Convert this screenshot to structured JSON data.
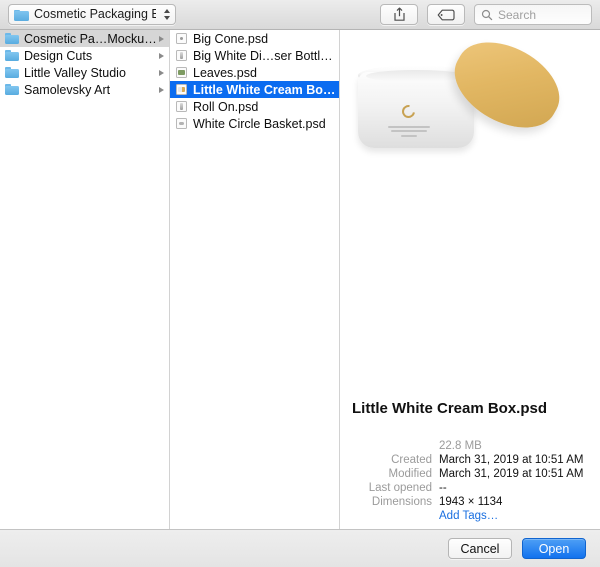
{
  "toolbar": {
    "location_label": "Cosmetic Packaging Br…",
    "folder_icon": "folder-icon",
    "chevron_icon": "chevron-up-down-icon",
    "share_icon": "share-icon",
    "tag_icon": "tag-icon",
    "search_icon": "search-icon",
    "search_placeholder": "Search",
    "search_value": ""
  },
  "sidebar": {
    "items": [
      {
        "label": "Cosmetic Pa…Mockup Zone",
        "selected": true
      },
      {
        "label": "Design Cuts",
        "selected": false
      },
      {
        "label": "Little Valley Studio",
        "selected": false
      },
      {
        "label": "Samolevsky Art",
        "selected": false
      }
    ]
  },
  "files": {
    "items": [
      {
        "label": "Big Cone.psd",
        "icon": "dot",
        "selected": false
      },
      {
        "label": "Big White Di…ser Bottle.psd",
        "icon": "bottle",
        "selected": false
      },
      {
        "label": "Leaves.psd",
        "icon": "leaf",
        "selected": false
      },
      {
        "label": "Little White Cream Box.psd",
        "icon": "box",
        "selected": true
      },
      {
        "label": "Roll On.psd",
        "icon": "bottle",
        "selected": false
      },
      {
        "label": "White Circle Basket.psd",
        "icon": "basket",
        "selected": false
      }
    ]
  },
  "preview": {
    "image_alt": "white-cream-jar-with-gold-lid",
    "title": "Little White Cream Box.psd",
    "size": "22.8 MB",
    "rows": [
      {
        "label": "Created",
        "value": "March 31, 2019 at 10:51 AM"
      },
      {
        "label": "Modified",
        "value": "March 31, 2019 at 10:51 AM"
      },
      {
        "label": "Last opened",
        "value": "--"
      },
      {
        "label": "Dimensions",
        "value": "1943 × 1134"
      }
    ],
    "add_tags_label": "Add Tags…"
  },
  "footer": {
    "cancel_label": "Cancel",
    "open_label": "Open"
  },
  "colors": {
    "selection_blue": "#0b6cf0",
    "default_button_blue": "#1272ee",
    "link_blue": "#1a6fe0",
    "folder_blue": "#58abdf"
  }
}
